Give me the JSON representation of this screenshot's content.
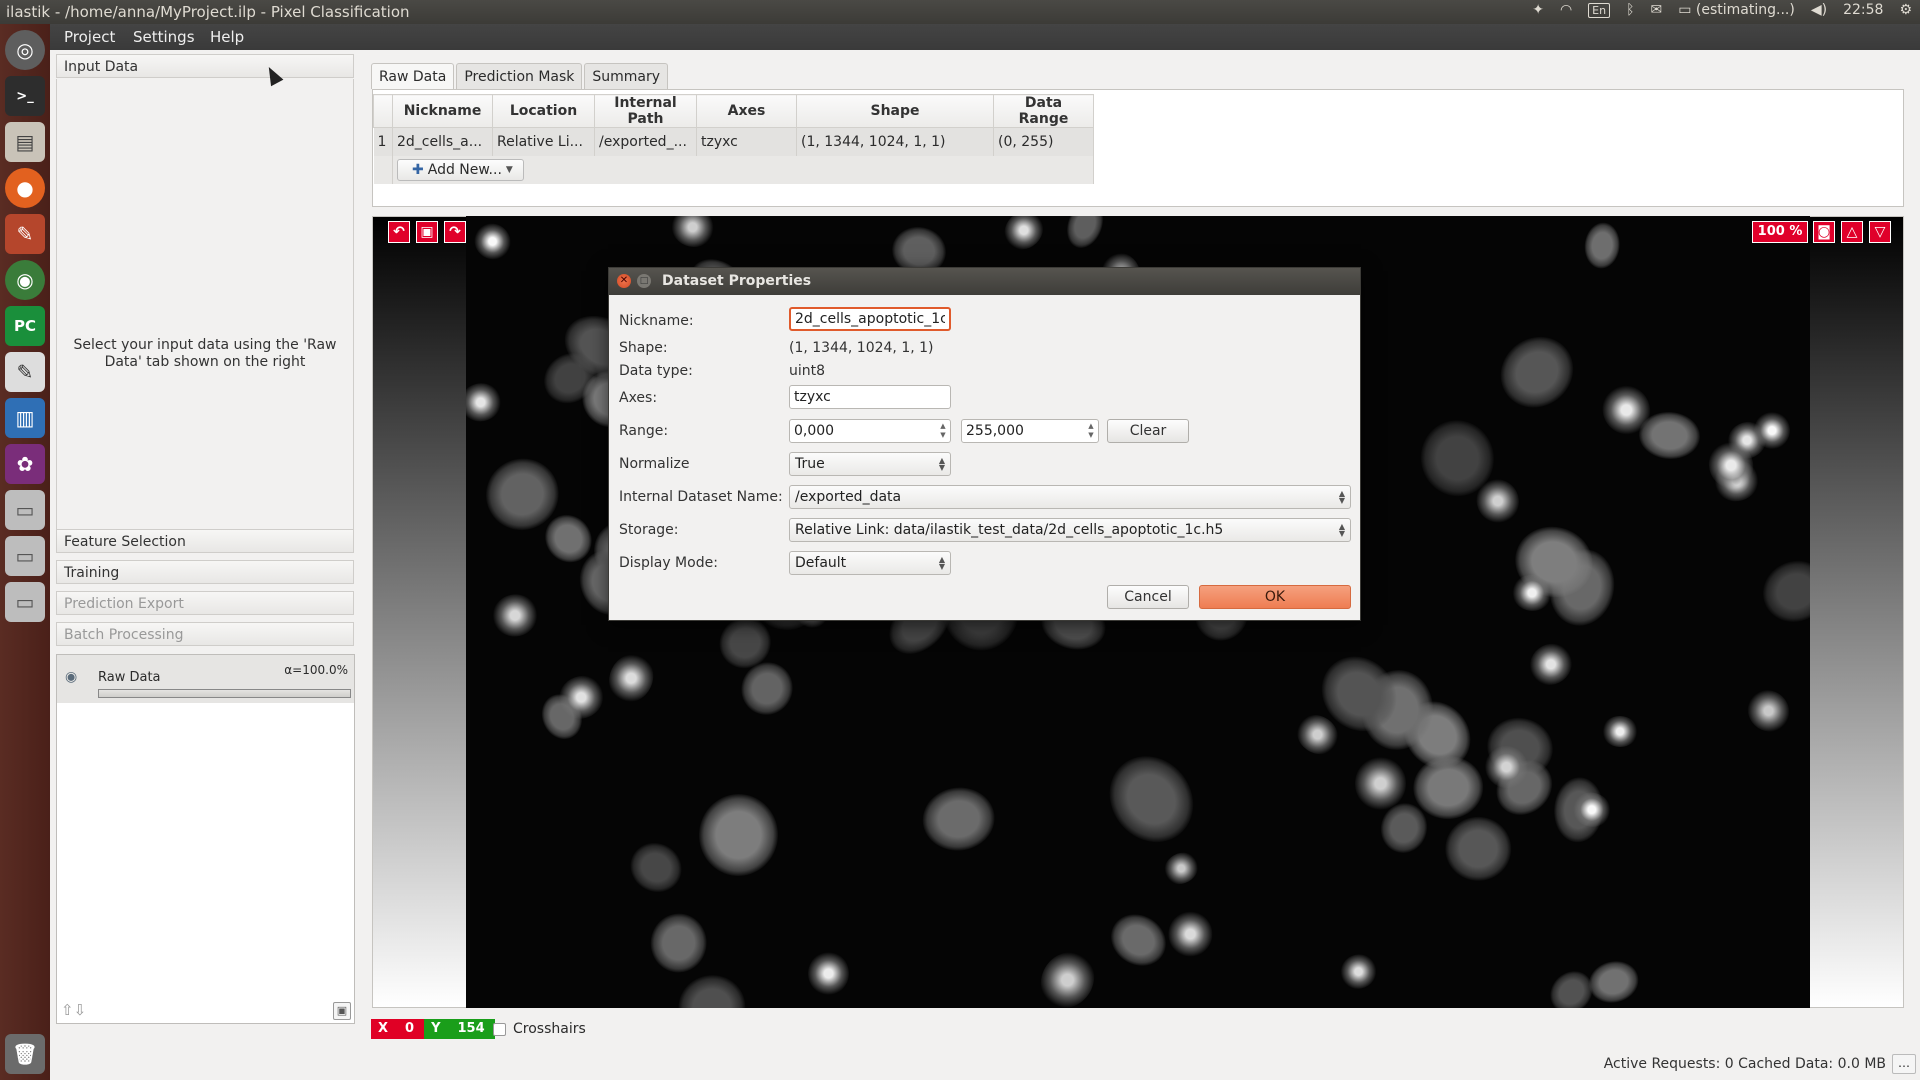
{
  "window_title": "ilastik - /home/anna/MyProject.ilp - Pixel Classification",
  "system_tray": {
    "keyboard": "En",
    "battery": "(estimating...)",
    "time": "22:58"
  },
  "menu": [
    "Project",
    "Settings",
    "Help"
  ],
  "applets": {
    "input_data": "Input Data",
    "hint": "Select your input data using the 'Raw Data' tab shown on the right",
    "feature_selection": "Feature Selection",
    "training": "Training",
    "prediction_export": "Prediction Export",
    "batch_processing": "Batch Processing"
  },
  "layer": {
    "name": "Raw Data",
    "alpha": "α=100.0%"
  },
  "tabs": [
    "Raw Data",
    "Prediction Mask",
    "Summary"
  ],
  "table": {
    "headers": [
      "Nickname",
      "Location",
      "Internal Path",
      "Axes",
      "Shape",
      "Data Range"
    ],
    "row": {
      "index": "1",
      "nickname": "2d_cells_a...",
      "location": "Relative Li...",
      "internal_path": "/exported_...",
      "axes": "tzyxc",
      "shape": "(1, 1344, 1024, 1, 1)",
      "data_range": "(0, 255)"
    },
    "add_new": "Add New..."
  },
  "viewer": {
    "zoom": "100 %"
  },
  "dialog": {
    "title": "Dataset Properties",
    "nickname_label": "Nickname:",
    "nickname": "2d_cells_apoptotic_1c",
    "shape_label": "Shape:",
    "shape": "(1, 1344, 1024, 1, 1)",
    "dtype_label": "Data type:",
    "dtype": "uint8",
    "axes_label": "Axes:",
    "axes": "tzyxc",
    "range_label": "Range:",
    "range_min": "0,000",
    "range_max": "255,000",
    "clear": "Clear",
    "normalize_label": "Normalize",
    "normalize": "True",
    "internal_label": "Internal Dataset Name:",
    "internal": "/exported_data",
    "storage_label": "Storage:",
    "storage": "Relative Link: data/ilastik_test_data/2d_cells_apoptotic_1c.h5",
    "display_label": "Display Mode:",
    "display": "Default",
    "cancel": "Cancel",
    "ok": "OK"
  },
  "coords": {
    "x_label": "X",
    "x": "0",
    "y_label": "Y",
    "y": "154"
  },
  "crosshairs": "Crosshairs",
  "status": "Active Requests: 0  Cached Data: 0.0 MB",
  "colors": {
    "accent": "#ee7d52",
    "x_badge": "#e00025",
    "y_badge": "#1a9e1a",
    "viewer_button": "#e0002a"
  }
}
